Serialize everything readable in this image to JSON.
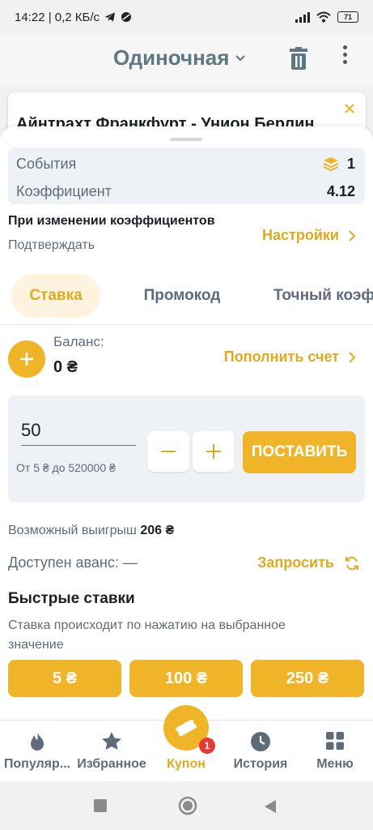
{
  "status_bar": {
    "time_speed": "14:22 | 0,2 КБ/с",
    "battery": "71"
  },
  "header": {
    "title": "Одиночная"
  },
  "event": {
    "name": "Айнтрахт Франкфурт - Унион Берлин"
  },
  "summary": {
    "events_label": "События",
    "events_value": "1",
    "coef_label": "Коэффициент",
    "coef_value": "4.12"
  },
  "odds_change": {
    "title": "При изменении коэффициентов",
    "mode": "Подтверждать",
    "settings_label": "Настройки"
  },
  "tabs": [
    {
      "label": "Ставка",
      "active": true
    },
    {
      "label": "Промокод",
      "active": false
    },
    {
      "label": "Точный коэффициент",
      "active": false
    }
  ],
  "balance": {
    "label": "Баланс:",
    "value": "0 ₴",
    "topup_label": "Пополнить счет"
  },
  "stake": {
    "amount": "50",
    "range": "От 5 ₴ до 520000 ₴",
    "minus": "−",
    "plus": "+",
    "place_label": "ПОСТАВИТЬ"
  },
  "possible_win": {
    "label": "Возможный выигрыш",
    "value": "206 ₴"
  },
  "advance": {
    "label": "Доступен аванс: —",
    "request_label": "Запросить"
  },
  "quick_bets": {
    "title": "Быстрые ставки",
    "description": "Ставка происходит по нажатию на выбранное значение",
    "values": [
      "5 ₴",
      "100 ₴",
      "250 ₴"
    ]
  },
  "bottom_nav": {
    "items": [
      {
        "label": "Популяр...",
        "icon": "fire-icon"
      },
      {
        "label": "Избранное",
        "icon": "star-icon"
      },
      {
        "label": "Купон",
        "icon": "ticket-icon",
        "badge": "1",
        "active": true
      },
      {
        "label": "История",
        "icon": "clock-icon"
      },
      {
        "label": "Меню",
        "icon": "grid-icon"
      }
    ]
  },
  "colors": {
    "accent": "#f0b429",
    "accent_text": "#e0aa20",
    "muted": "#5f6b78",
    "badge": "#e53935"
  }
}
